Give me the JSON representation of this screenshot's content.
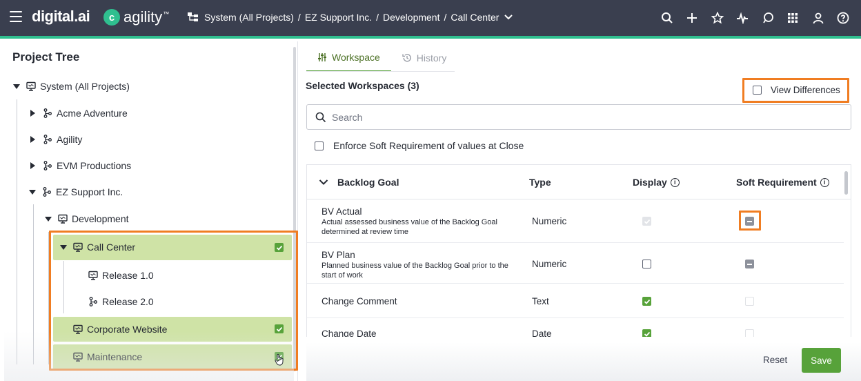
{
  "header": {
    "brand": "digital.ai",
    "product": "agility",
    "product_initial": "c",
    "breadcrumb": [
      "System (All Projects)",
      "EZ Support Inc.",
      "Development",
      "Call Center"
    ],
    "icons": [
      "search-icon",
      "plus-icon",
      "star-icon",
      "activity-icon",
      "chat-icon",
      "apps-grid-icon",
      "user-icon",
      "help-icon"
    ],
    "accent_color": "#2fbf8f"
  },
  "left_panel": {
    "title": "Project Tree",
    "nodes": [
      {
        "label": "System (All Projects)",
        "expanded": true
      },
      {
        "label": "Acme Adventure",
        "expanded": false
      },
      {
        "label": "Agility",
        "expanded": false
      },
      {
        "label": "EVM Productions",
        "expanded": false
      },
      {
        "label": "EZ Support Inc.",
        "expanded": true
      },
      {
        "label": "Development",
        "expanded": true
      },
      {
        "label": "Call Center",
        "expanded": true,
        "selected": true
      },
      {
        "label": "Release 1.0"
      },
      {
        "label": "Release 2.0"
      },
      {
        "label": "Corporate Website",
        "selected": true
      },
      {
        "label": "Maintenance",
        "selected": true
      }
    ]
  },
  "tabs": [
    {
      "label": "Workspace",
      "active": true
    },
    {
      "label": "History",
      "active": false
    }
  ],
  "selected_workspaces": "Selected Workspaces (3)",
  "view_differences": "View Differences",
  "search": {
    "placeholder": "Search"
  },
  "enforce_label": "Enforce Soft Requirement of values at Close",
  "grid": {
    "group": "Backlog Goal",
    "columns": {
      "type": "Type",
      "display": "Display",
      "soft": "Soft Requirement"
    },
    "rows": [
      {
        "name": "BV Actual",
        "desc": "Actual assessed business value of the Backlog Goal determined at review time",
        "type": "Numeric",
        "display": "disabled-checked",
        "soft": "indeterminate"
      },
      {
        "name": "BV Plan",
        "desc": "Planned business value of the Backlog Goal prior to the start of work",
        "type": "Numeric",
        "display": "unchecked",
        "soft": "indeterminate"
      },
      {
        "name": "Change Comment",
        "desc": "",
        "type": "Text",
        "display": "checked",
        "soft": "disabled"
      },
      {
        "name": "Change Date",
        "desc": "",
        "type": "Date",
        "display": "checked",
        "soft": "disabled"
      }
    ]
  },
  "footer": {
    "reset": "Reset",
    "save": "Save"
  },
  "colors": {
    "header_bg": "#3a3f4f",
    "selected_row": "#cfe3a6",
    "check_green": "#57a23a",
    "highlight_orange": "#f07d22"
  }
}
